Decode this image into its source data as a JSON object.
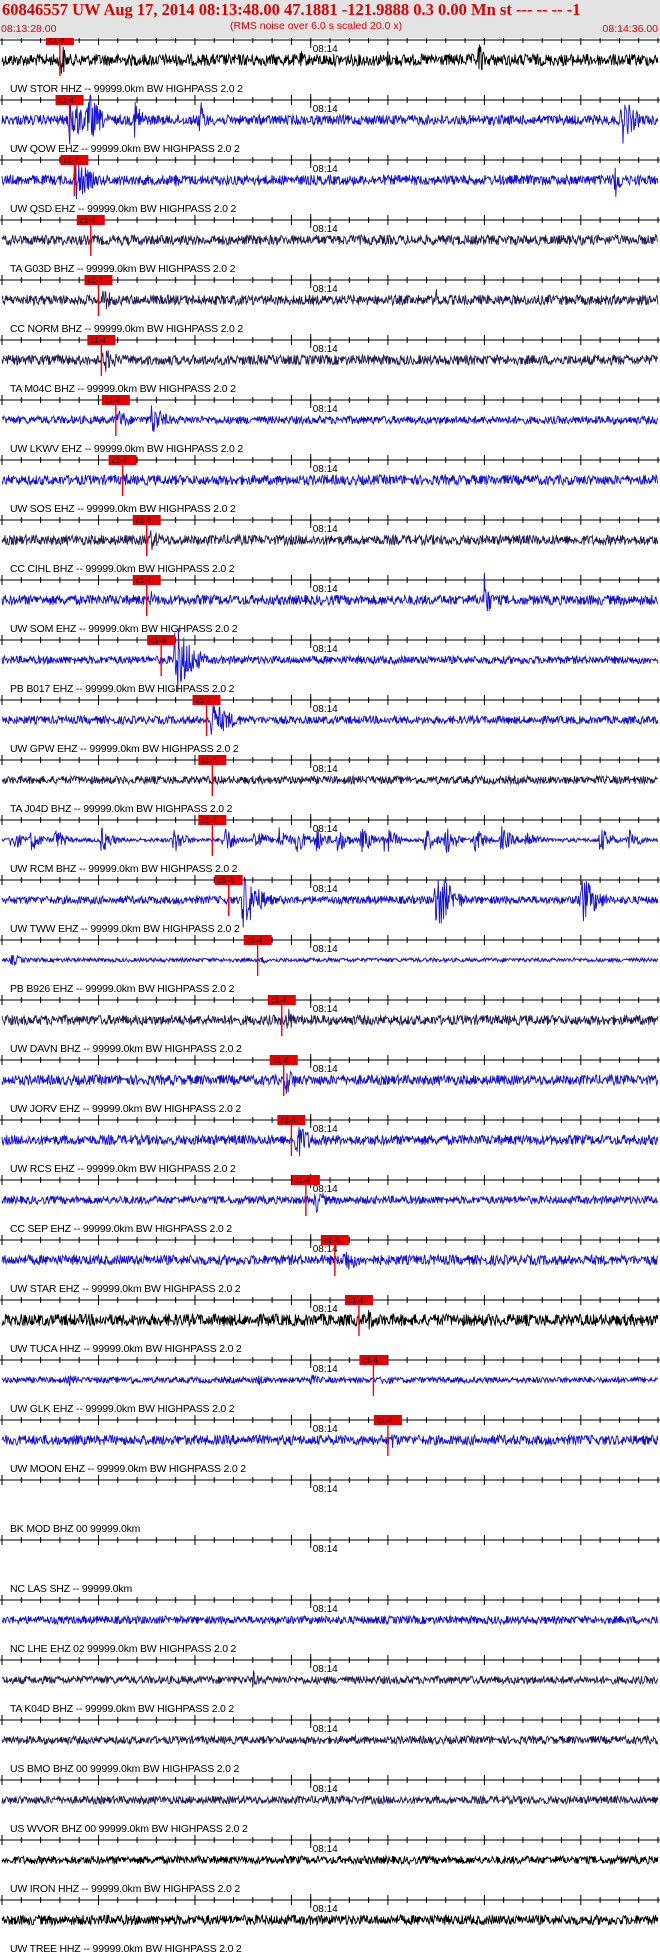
{
  "header": {
    "title": "60846557 UW Aug 17, 2014 08:13:48.00   47.1881 -121.9888  0.3 0.00 Mn st --- -- --   -1",
    "start_time": "08:13:28.00",
    "rms_note": "(RMS noise over 6.0 s scaled 20.0 x)",
    "end_time": "08:14:36.00"
  },
  "chart_data": {
    "type": "line",
    "title": "60846557 UW Aug 17, 2014 08:13:48.00   47.1881 -121.9888  0.3 0.00 Mn st --- -- --   -1",
    "time_range": [
      "08:13:28.00",
      "08:14:36.00"
    ],
    "minute_tick_label": "08:14",
    "minute_tick_seconds": 32,
    "window_seconds": 68,
    "pick_label": "c1-4",
    "grid": true,
    "colors": {
      "blue": "#1414dc",
      "dark": "#281e5a",
      "black": "#000000",
      "pick": "#e60000",
      "pick_line": "#ff0000"
    },
    "traces": [
      {
        "label": "UW STOR HHZ -- 99999.0km BW  HIGHPASS  2.0  2",
        "color": "black",
        "amp": 6,
        "pick_s": 6.0,
        "bursts": [
          [
            6.2,
            22,
            0.8
          ],
          [
            31.0,
            10,
            0.8
          ],
          [
            40.0,
            10,
            0.8
          ],
          [
            49.5,
            24,
            0.7
          ],
          [
            55.0,
            8,
            0.5
          ],
          [
            62.5,
            6,
            0.4
          ]
        ]
      },
      {
        "label": "UW QOW EHZ -- 99999.0km BW  HIGHPASS  2.0  2",
        "color": "blue",
        "amp": 5,
        "pick_s": 7.0,
        "bursts": [
          [
            7.0,
            28,
            3.0
          ],
          [
            9.0,
            30,
            2.2
          ],
          [
            13.8,
            24,
            1.5
          ],
          [
            20.5,
            24,
            1.0
          ],
          [
            64.3,
            26,
            2.5
          ]
        ]
      },
      {
        "label": "UW QSD EHZ -- 99999.0km BW  HIGHPASS  2.0  2",
        "color": "blue",
        "amp": 5,
        "pick_s": 7.5,
        "bursts": [
          [
            7.6,
            24,
            3.0
          ],
          [
            18.0,
            8,
            1.5
          ],
          [
            63.5,
            22,
            1.2
          ]
        ]
      },
      {
        "label": "TA G03D BHZ -- 99999.0km BW  HIGHPASS  2.0  2",
        "color": "dark",
        "amp": 5,
        "pick_s": 9.2,
        "bursts": [
          [
            9.4,
            5,
            1.5
          ]
        ]
      },
      {
        "label": "CC NORM BHZ -- 99999.0km BW  HIGHPASS  2.0  2",
        "color": "dark",
        "amp": 5,
        "pick_s": 10.0,
        "bursts": [
          [
            10.4,
            12,
            3.0
          ],
          [
            45.0,
            12,
            1.2
          ]
        ]
      },
      {
        "label": "TA M04C BHZ -- 99999.0km BW  HIGHPASS  2.0  2",
        "color": "dark",
        "amp": 5,
        "pick_s": 10.3,
        "bursts": [
          [
            10.5,
            14,
            3.0
          ]
        ]
      },
      {
        "label": "UW LKWV EHZ -- 99999.0km BW  HIGHPASS  2.0  2",
        "color": "blue",
        "amp": 4,
        "pick_s": 11.8,
        "bursts": [
          [
            12.0,
            12,
            2.5
          ],
          [
            15.5,
            18,
            2.5
          ]
        ]
      },
      {
        "label": "UW SOS EHZ -- 99999.0km BW  HIGHPASS  2.0  2",
        "color": "blue",
        "amp": 5,
        "pick_s": 12.5,
        "bursts": [
          [
            12.8,
            8,
            1.5
          ]
        ]
      },
      {
        "label": "CC CIHL BHZ -- 99999.0km BW  HIGHPASS  2.0  2",
        "color": "dark",
        "amp": 5,
        "pick_s": 15.0,
        "bursts": [
          [
            15.3,
            12,
            3.0
          ]
        ]
      },
      {
        "label": "UW SOM EHZ -- 99999.0km BW  HIGHPASS  2.0  2",
        "color": "blue",
        "amp": 5,
        "pick_s": 15.0,
        "bursts": [
          [
            15.5,
            10,
            1.0
          ],
          [
            50.0,
            30,
            1.0
          ]
        ]
      },
      {
        "label": "PB B017 EHZ -- 99999.0km BW  HIGHPASS  2.0  2",
        "color": "blue",
        "amp": 4,
        "pick_s": 16.5,
        "bursts": [
          [
            18.0,
            40,
            3.0
          ]
        ]
      },
      {
        "label": "UW GPW EHZ -- 99999.0km BW  HIGHPASS  2.0  2",
        "color": "blue",
        "amp": 4,
        "pick_s": 21.2,
        "bursts": [
          [
            21.7,
            20,
            4.0
          ]
        ]
      },
      {
        "label": "TA J04D BHZ -- 99999.0km BW  HIGHPASS  2.0  2",
        "color": "dark",
        "amp": 4,
        "pick_s": 21.8,
        "bursts": [
          [
            22.3,
            6,
            1.5
          ]
        ]
      },
      {
        "label": "UW RCM BHZ -- 99999.0km BW  HIGHPASS  2.0  2",
        "color": "blue",
        "amp": 2,
        "pick_s": 21.8,
        "bursts": [
          [
            1.0,
            12,
            2.2
          ],
          [
            3.0,
            12,
            2.2
          ],
          [
            5.5,
            12,
            2.2
          ],
          [
            10.3,
            14,
            2.2
          ],
          [
            17.8,
            14,
            2.2
          ],
          [
            23.0,
            16,
            2.2
          ],
          [
            26.2,
            14,
            2.2
          ],
          [
            28.7,
            14,
            2.2
          ],
          [
            30.5,
            14,
            2.2
          ],
          [
            32.5,
            14,
            2.2
          ],
          [
            34.8,
            14,
            2.2
          ],
          [
            37.3,
            14,
            2.2
          ],
          [
            39.7,
            16,
            2.2
          ],
          [
            43.8,
            14,
            2.2
          ],
          [
            46.0,
            16,
            2.2
          ],
          [
            49.0,
            14,
            2.2
          ],
          [
            51.8,
            14,
            2.2
          ],
          [
            54.3,
            12,
            2.2
          ],
          [
            62.0,
            14,
            2.2
          ],
          [
            65.0,
            12,
            2.2
          ]
        ]
      },
      {
        "label": "UW TWW EHZ -- 99999.0km BW  HIGHPASS  2.0  2",
        "color": "blue",
        "amp": 4,
        "pick_s": 23.5,
        "bursts": [
          [
            25.0,
            32,
            3.0
          ],
          [
            45.0,
            34,
            3.0
          ],
          [
            60.0,
            28,
            3.0
          ]
        ]
      },
      {
        "label": "PB B926 EHZ -- 99999.0km BW  HIGHPASS  2.0  2",
        "color": "blue",
        "amp": 2,
        "pick_s": 26.5,
        "bursts": [
          [
            1.0,
            6,
            3.0
          ],
          [
            27.0,
            4,
            2.0
          ]
        ]
      },
      {
        "label": "UW DAVN BHZ -- 99999.0km BW  HIGHPASS  2.0  2",
        "color": "dark",
        "amp": 5,
        "pick_s": 29.0,
        "bursts": [
          [
            29.5,
            16,
            1.5
          ]
        ]
      },
      {
        "label": "UW JORV EHZ -- 99999.0km BW  HIGHPASS  2.0  2",
        "color": "blue",
        "amp": 5,
        "pick_s": 29.2,
        "bursts": [
          [
            29.5,
            16,
            2.0
          ]
        ]
      },
      {
        "label": "UW RCS EHZ -- 99999.0km BW  HIGHPASS  2.0  2",
        "color": "blue",
        "amp": 5,
        "pick_s": 30.0,
        "bursts": [
          [
            8.5,
            6,
            3.0
          ],
          [
            30.5,
            20,
            3.0
          ]
        ]
      },
      {
        "label": "CC SEP EHZ -- 99999.0km BW  HIGHPASS  2.0  2",
        "color": "blue",
        "amp": 4,
        "pick_s": 31.5,
        "bursts": [
          [
            32.5,
            14,
            2.0
          ]
        ]
      },
      {
        "label": "UW STAR EHZ -- 99999.0km BW  HIGHPASS  2.0  2",
        "color": "blue",
        "amp": 5,
        "pick_s": 34.5,
        "bursts": [
          [
            35.5,
            14,
            3.0
          ]
        ]
      },
      {
        "label": "UW TUCA HHZ -- 99999.0km BW  HIGHPASS  2.0  2",
        "color": "black",
        "amp": 6,
        "pick_s": 37.0,
        "bursts": [
          [
            38.0,
            12,
            1.5
          ]
        ]
      },
      {
        "label": "UW GLK EHZ -- 99999.0km BW  HIGHPASS  2.0  2",
        "color": "blue",
        "amp": 3,
        "pick_s": 38.5,
        "bursts": [
          [
            39.5,
            6,
            3.0
          ],
          [
            7.0,
            6,
            3.0
          ],
          [
            13.0,
            6,
            3.0
          ],
          [
            26.5,
            6,
            2.5
          ],
          [
            32.0,
            6,
            2.5
          ]
        ]
      },
      {
        "label": "UW MOON EHZ -- 99999.0km BW  HIGHPASS  2.0  2",
        "color": "blue",
        "amp": 5,
        "pick_s": 40.0,
        "bursts": [
          [
            40.5,
            10,
            1.5
          ]
        ]
      },
      {
        "label": "BK MOD BHZ 00 99999.0km",
        "color": "none",
        "amp": 0,
        "bursts": []
      },
      {
        "label": "NC LAS SHZ -- 99999.0km",
        "color": "none",
        "amp": 0,
        "bursts": []
      },
      {
        "label": "NC LHE EHZ 02 99999.0km BW  HIGHPASS  2.0  2",
        "color": "blue",
        "amp": 4,
        "bursts": []
      },
      {
        "label": "TA K04D BHZ -- 99999.0km BW  HIGHPASS  2.0  2",
        "color": "dark",
        "amp": 4,
        "bursts": [
          [
            26.0,
            10,
            1.3
          ]
        ]
      },
      {
        "label": "US BMO BHZ 00 99999.0km BW  HIGHPASS  2.0  2",
        "color": "dark",
        "amp": 4,
        "bursts": []
      },
      {
        "label": "US WVOR BHZ 00 99999.0km BW  HIGHPASS  2.0  2",
        "color": "dark",
        "amp": 4,
        "bursts": [
          [
            36.0,
            6,
            1.8
          ]
        ]
      },
      {
        "label": "UW IRON HHZ -- 99999.0km BW  HIGHPASS  2.0  2",
        "color": "black",
        "amp": 4,
        "bursts": []
      },
      {
        "label": "UW TREE HHZ -- 99999.0km BW  HIGHPASS  2.0  2",
        "color": "black",
        "amp": 5,
        "bursts": []
      }
    ]
  }
}
